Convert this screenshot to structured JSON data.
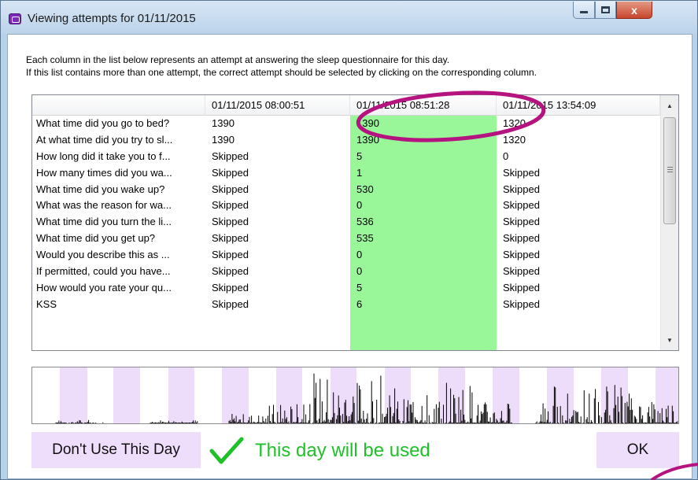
{
  "window": {
    "title": "Viewing attempts for 01/11/2015",
    "close_glyph": "x"
  },
  "intro": {
    "line1": "Each column in the list below represents an attempt at answering the sleep questionnaire for this day.",
    "line2": "If this list contains more than one attempt, the correct attempt should be selected by clicking on the corresponding column."
  },
  "list": {
    "columns": [
      "01/11/2015 08:00:51",
      "01/11/2015 08:51:28",
      "01/11/2015 13:54:09"
    ],
    "selected_column": 1,
    "rows": [
      {
        "question": "What time did you go to bed?",
        "values": [
          "1390",
          "1390",
          "1320"
        ]
      },
      {
        "question": "At what time did you try to sl...",
        "values": [
          "1390",
          "1390",
          "1320"
        ]
      },
      {
        "question": "How long did it take you to f...",
        "values": [
          "Skipped",
          "5",
          "0"
        ]
      },
      {
        "question": "How many times did you wa...",
        "values": [
          "Skipped",
          "1",
          "Skipped"
        ]
      },
      {
        "question": "What time did you wake up?",
        "values": [
          "Skipped",
          "530",
          "Skipped"
        ]
      },
      {
        "question": "What was the reason for wa...",
        "values": [
          "Skipped",
          "0",
          "Skipped"
        ]
      },
      {
        "question": "What time did you turn the li...",
        "values": [
          "Skipped",
          "536",
          "Skipped"
        ]
      },
      {
        "question": "What time did you get up?",
        "values": [
          "Skipped",
          "535",
          "Skipped"
        ]
      },
      {
        "question": "Would you describe this as ...",
        "values": [
          "Skipped",
          "0",
          "Skipped"
        ]
      },
      {
        "question": "If permitted, could you have...",
        "values": [
          "Skipped",
          "0",
          "Skipped"
        ]
      },
      {
        "question": "How would you rate your qu...",
        "values": [
          "Skipped",
          "5",
          "Skipped"
        ]
      },
      {
        "question": "KSS",
        "values": [
          "Skipped",
          "6",
          "Skipped"
        ]
      }
    ]
  },
  "footer": {
    "dont_use_label": "Don't Use This Day",
    "status_text": "This day will be used",
    "ok_label": "OK"
  },
  "colors": {
    "selected_column": "#99f79a",
    "button_bg": "#efddfc",
    "status_green": "#1ec128",
    "annotation": "#b5137f",
    "plot_band": "#eedcfb"
  }
}
